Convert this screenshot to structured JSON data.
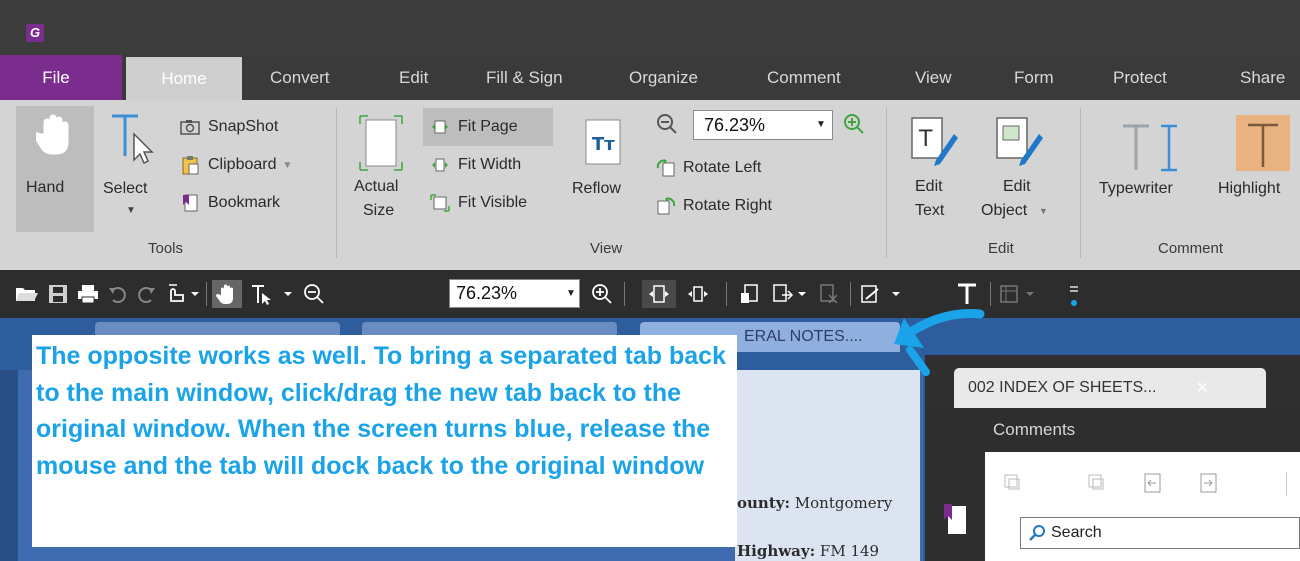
{
  "app": {
    "logo_letter": "G"
  },
  "menu_tabs": {
    "file": "File",
    "home": "Home",
    "convert": "Convert",
    "edit": "Edit",
    "fill_sign": "Fill & Sign",
    "organize": "Organize",
    "comment": "Comment",
    "view": "View",
    "form": "Form",
    "protect": "Protect",
    "share": "Share"
  },
  "ribbon": {
    "tools": {
      "hand": "Hand",
      "select": "Select",
      "snapshot": "SnapShot",
      "clipboard": "Clipboard",
      "bookmark": "Bookmark",
      "group": "Tools"
    },
    "view": {
      "actual_size_1": "Actual",
      "actual_size_2": "Size",
      "fit_page": "Fit Page",
      "fit_width": "Fit Width",
      "fit_visible": "Fit Visible",
      "reflow": "Reflow",
      "zoom_value": "76.23%",
      "rotate_left": "Rotate Left",
      "rotate_right": "Rotate Right",
      "group": "View"
    },
    "edit": {
      "edit_text_1": "Edit",
      "edit_text_2": "Text",
      "edit_object_1": "Edit",
      "edit_object_2": "Object",
      "group": "Edit"
    },
    "comment": {
      "typewriter": "Typewriter",
      "highlight": "Highlight",
      "group": "Comment"
    }
  },
  "toolbar": {
    "zoom_value": "76.23%"
  },
  "document": {
    "tab3_label": "ERAL NOTES....",
    "county_label": "ounty:",
    "county_value": " Montgomery",
    "highway_label": "Highway:",
    "highway_value": " FM 149"
  },
  "new_window": {
    "tab_label": "002 INDEX OF SHEETS...",
    "close": "×",
    "comments_label": "Comments",
    "search_placeholder": "Search"
  },
  "annotation": {
    "text": "The opposite works as well.  To bring a separated tab back to the main window, click/drag the new tab back to the original window.  When the screen turns blue, release the mouse and the tab will dock back to the original window"
  },
  "colors": {
    "accent_purple": "#7b2d8e",
    "annotation_blue": "#1aa3e8",
    "drop_blue": "#2e5d9e"
  }
}
